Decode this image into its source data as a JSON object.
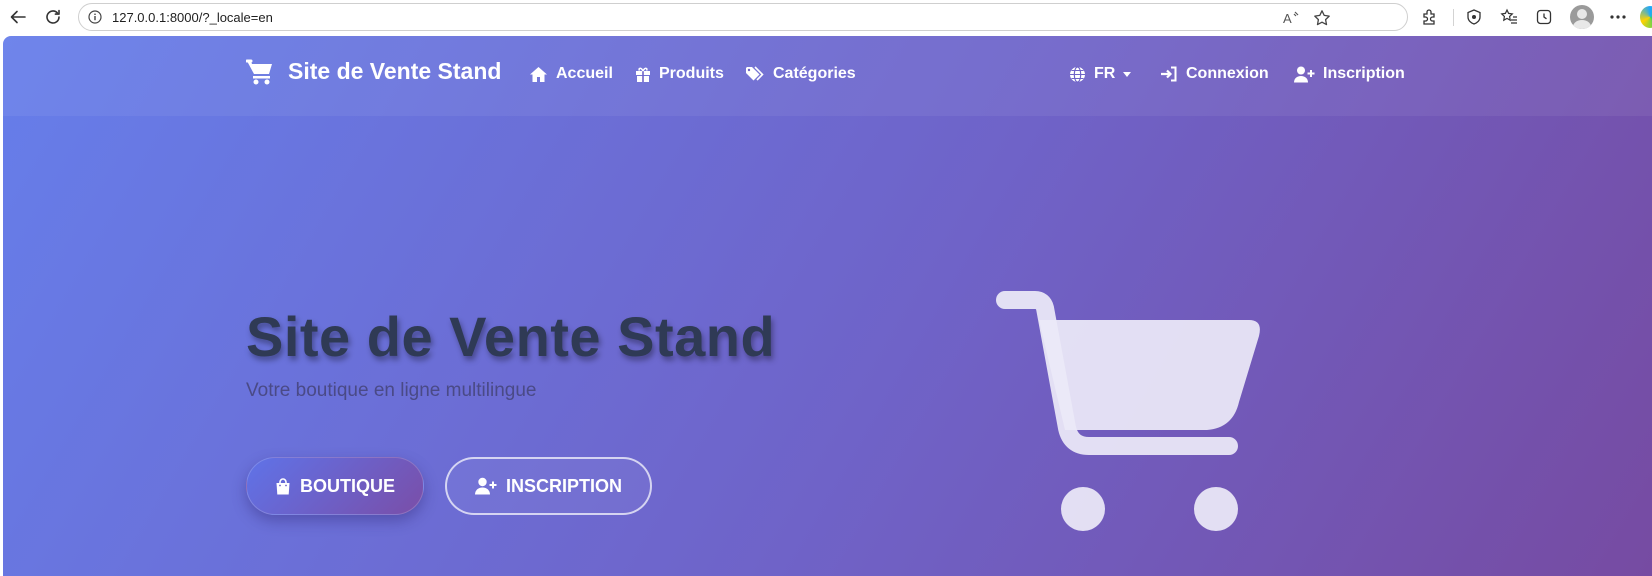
{
  "browser": {
    "url": "127.0.0.1:8000/?_locale=en"
  },
  "navbar": {
    "brand": "Site de Vente Stand",
    "links": {
      "home": "Accueil",
      "products": "Produits",
      "categories": "Catégories"
    },
    "language": "FR",
    "login": "Connexion",
    "register": "Inscription"
  },
  "hero": {
    "title": "Site de Vente Stand",
    "subtitle": "Votre boutique en ligne multilingue",
    "shop_button": "BOUTIQUE",
    "register_button": "INSCRIPTION"
  },
  "colors": {
    "gradient_start": "#667eea",
    "gradient_end": "#764ba2",
    "title_text": "#2f3a55"
  },
  "icons": [
    "back-arrow-icon",
    "refresh-icon",
    "info-icon",
    "read-aloud-icon",
    "favorite-star-icon",
    "extensions-icon",
    "browser-essentials-icon",
    "favorites-icon",
    "history-icon",
    "profile-avatar",
    "more-icon",
    "cart-icon",
    "home-icon",
    "gift-icon",
    "tags-icon",
    "globe-icon",
    "sign-in-icon",
    "user-plus-icon",
    "shopping-bag-icon",
    "cart-illustration-icon"
  ]
}
